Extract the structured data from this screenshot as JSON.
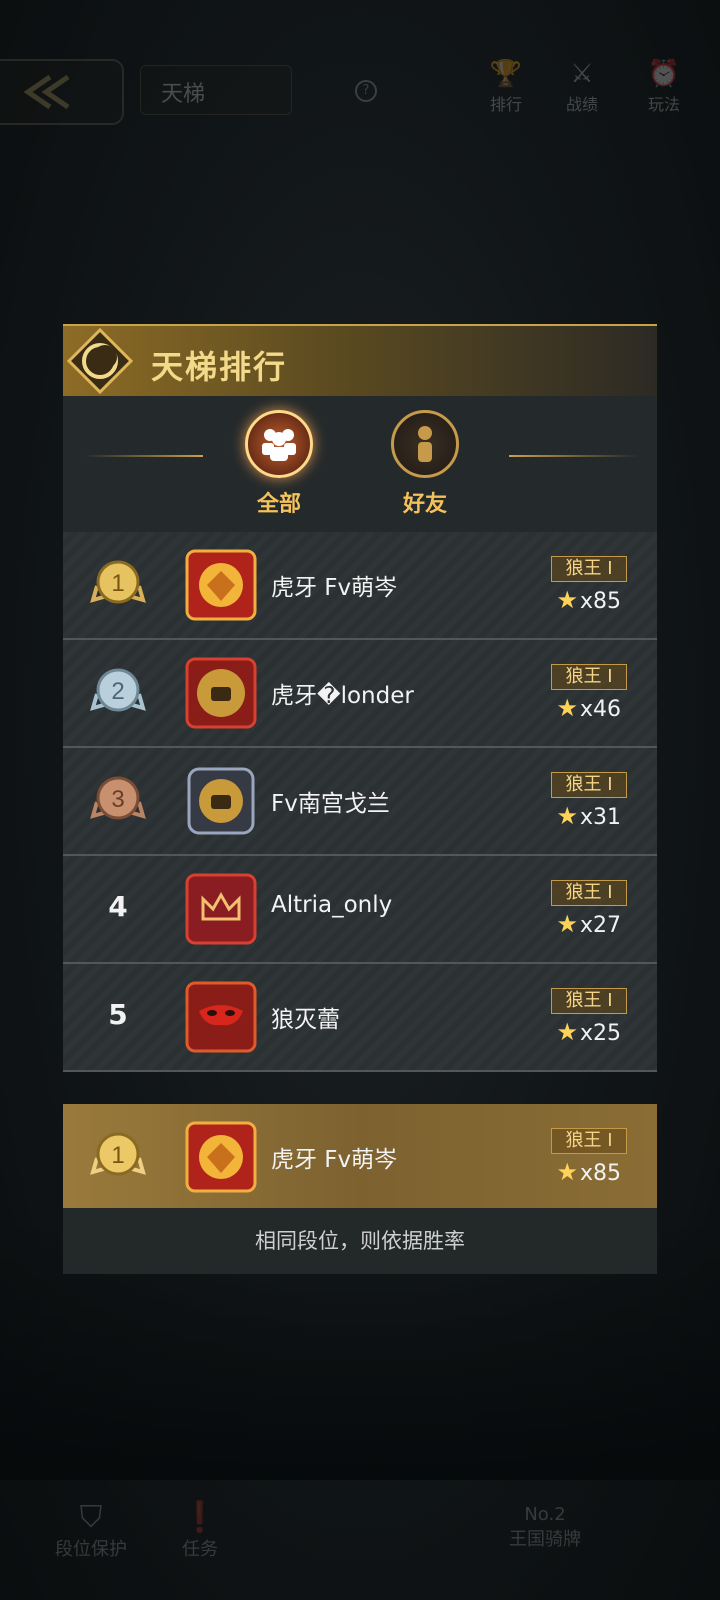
{
  "topbar": {
    "title": "天梯",
    "icons": [
      {
        "name": "trophy-icon",
        "label": "排行"
      },
      {
        "name": "battle-icon",
        "label": "战绩"
      },
      {
        "name": "alarm-icon",
        "label": "玩法"
      }
    ]
  },
  "bottombar": {
    "items": [
      {
        "name": "rank-protect-icon",
        "label": "段位保护"
      },
      {
        "name": "task-icon",
        "label": "任务"
      }
    ],
    "right_line1": "No.2",
    "right_line2": "王国骑牌"
  },
  "panel": {
    "title": "天梯排行",
    "tabs": [
      {
        "label": "全部",
        "active": true
      },
      {
        "label": "好友",
        "active": false
      }
    ],
    "rows": [
      {
        "rank": "1",
        "name": "虎牙 Fv萌岑",
        "tier": "狼王 I",
        "stars": "x85"
      },
      {
        "rank": "2",
        "name": "虎牙�londer",
        "tier": "狼王 I",
        "stars": "x46"
      },
      {
        "rank": "3",
        "name": "Fv南宫戈兰",
        "tier": "狼王 I",
        "stars": "x31"
      },
      {
        "rank": "4",
        "name": "Altria_only",
        "tier": "狼王 I",
        "stars": "x27"
      },
      {
        "rank": "5",
        "name": "狼灭蕾",
        "tier": "狼王 I",
        "stars": "x25"
      }
    ],
    "my_row": {
      "rank": "1",
      "name": "虎牙 Fv萌岑",
      "tier": "狼王 I",
      "stars": "x85"
    },
    "footer": "相同段位，则依据胜率"
  },
  "colors": {
    "gold": "#f3c25b",
    "accent": "#c69a4a"
  }
}
